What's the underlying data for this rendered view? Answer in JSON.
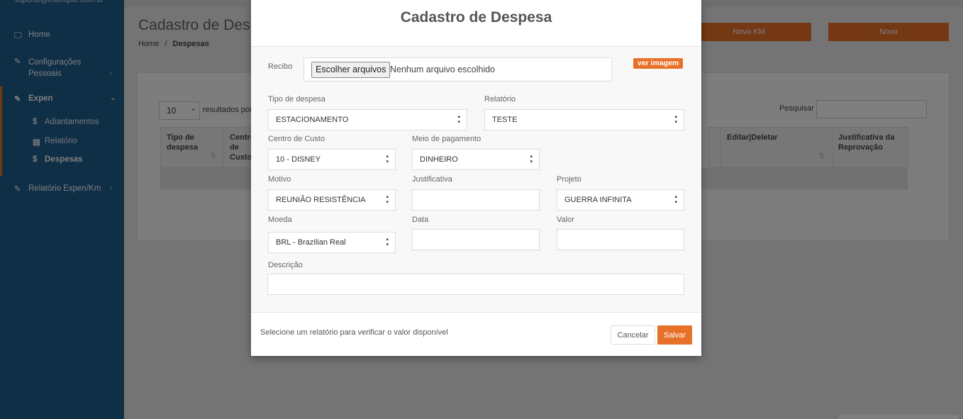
{
  "sidebar": {
    "user_email": "suporte@exemplo.com.br",
    "items": [
      {
        "label": "Home",
        "icon": "laptop-icon"
      },
      {
        "label": "Configurações Pessoais",
        "icon": "edit-icon"
      },
      {
        "label": "Expen",
        "icon": "edit-icon"
      },
      {
        "label": "Relatório Expen/Km",
        "icon": "edit-icon"
      }
    ],
    "subitems": [
      {
        "label": "Adiantamentos",
        "icon": "$"
      },
      {
        "label": "Relatório",
        "icon": "table-icon"
      },
      {
        "label": "Despesas",
        "icon": "$"
      }
    ]
  },
  "page": {
    "title": "Cadastro de Despesas",
    "breadcrumb_home": "Home",
    "breadcrumb_sep": "/",
    "breadcrumb_current": "Despesas",
    "btn_novo_km": "Novo KM",
    "btn_novo": "Novo",
    "length_value": "10",
    "length_text": "resultados por página",
    "search_label": "Pesquisar",
    "columns": [
      {
        "label": "Tipo de despesa"
      },
      {
        "label": "Centro de Custo"
      },
      {
        "label": "Editar|Deletar"
      },
      {
        "label": "Justificativa da Reprovação"
      }
    ]
  },
  "modal": {
    "title": "Cadastro de Despesa",
    "recibo_label": "Recibo",
    "file_button": "Escolher arquivos",
    "file_status": "Nenhum arquivo escolhido",
    "view_image": "ver imagem",
    "tipo_label": "Tipo de despesa",
    "tipo_value": "ESTACIONAMENTO",
    "relatorio_label": "Relatório",
    "relatorio_value": "TESTE",
    "centro_label": "Centro de Custo",
    "centro_value": "10 - DISNEY",
    "meio_label": "Meio de pagamento",
    "meio_value": "DINHEIRO",
    "motivo_label": "Motivo",
    "motivo_value": "REUNIÃO RESISTÊNCIA",
    "justificativa_label": "Justificativa",
    "justificativa_value": "",
    "projeto_label": "Projeto",
    "projeto_value": "GUERRA INFINITA",
    "moeda_label": "Moeda",
    "moeda_value": "BRL - Brazilian Real",
    "data_label": "Data",
    "data_value": "",
    "valor_label": "Valor",
    "valor_value": "",
    "descricao_label": "Descrição",
    "descricao_value": "",
    "footer_message": "Selecione um relatório para verificar o valor disponível",
    "cancel_label": "Cancelar",
    "save_label": "Salvar"
  },
  "colors": {
    "sidebar": "#1f5f8f",
    "accent": "#e8712a"
  }
}
